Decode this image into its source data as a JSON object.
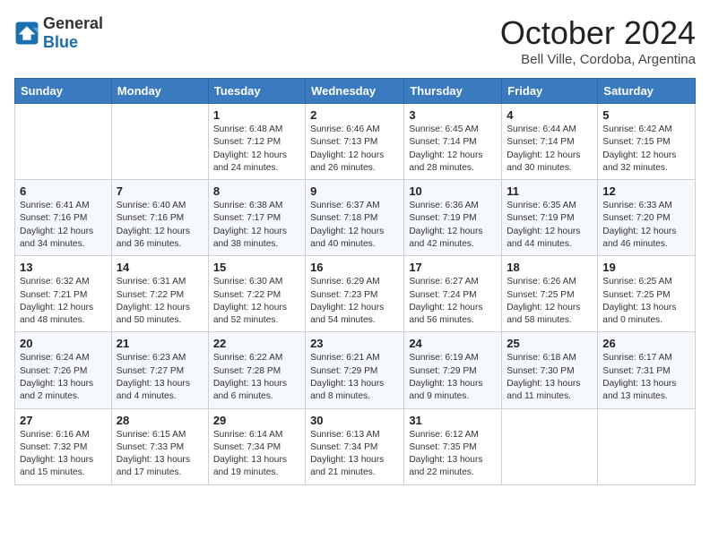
{
  "logo": {
    "general": "General",
    "blue": "Blue"
  },
  "title": "October 2024",
  "location": "Bell Ville, Cordoba, Argentina",
  "weekdays": [
    "Sunday",
    "Monday",
    "Tuesday",
    "Wednesday",
    "Thursday",
    "Friday",
    "Saturday"
  ],
  "weeks": [
    [
      {
        "day": "",
        "info": ""
      },
      {
        "day": "",
        "info": ""
      },
      {
        "day": "1",
        "info": "Sunrise: 6:48 AM\nSunset: 7:12 PM\nDaylight: 12 hours\nand 24 minutes."
      },
      {
        "day": "2",
        "info": "Sunrise: 6:46 AM\nSunset: 7:13 PM\nDaylight: 12 hours\nand 26 minutes."
      },
      {
        "day": "3",
        "info": "Sunrise: 6:45 AM\nSunset: 7:14 PM\nDaylight: 12 hours\nand 28 minutes."
      },
      {
        "day": "4",
        "info": "Sunrise: 6:44 AM\nSunset: 7:14 PM\nDaylight: 12 hours\nand 30 minutes."
      },
      {
        "day": "5",
        "info": "Sunrise: 6:42 AM\nSunset: 7:15 PM\nDaylight: 12 hours\nand 32 minutes."
      }
    ],
    [
      {
        "day": "6",
        "info": "Sunrise: 6:41 AM\nSunset: 7:16 PM\nDaylight: 12 hours\nand 34 minutes."
      },
      {
        "day": "7",
        "info": "Sunrise: 6:40 AM\nSunset: 7:16 PM\nDaylight: 12 hours\nand 36 minutes."
      },
      {
        "day": "8",
        "info": "Sunrise: 6:38 AM\nSunset: 7:17 PM\nDaylight: 12 hours\nand 38 minutes."
      },
      {
        "day": "9",
        "info": "Sunrise: 6:37 AM\nSunset: 7:18 PM\nDaylight: 12 hours\nand 40 minutes."
      },
      {
        "day": "10",
        "info": "Sunrise: 6:36 AM\nSunset: 7:19 PM\nDaylight: 12 hours\nand 42 minutes."
      },
      {
        "day": "11",
        "info": "Sunrise: 6:35 AM\nSunset: 7:19 PM\nDaylight: 12 hours\nand 44 minutes."
      },
      {
        "day": "12",
        "info": "Sunrise: 6:33 AM\nSunset: 7:20 PM\nDaylight: 12 hours\nand 46 minutes."
      }
    ],
    [
      {
        "day": "13",
        "info": "Sunrise: 6:32 AM\nSunset: 7:21 PM\nDaylight: 12 hours\nand 48 minutes."
      },
      {
        "day": "14",
        "info": "Sunrise: 6:31 AM\nSunset: 7:22 PM\nDaylight: 12 hours\nand 50 minutes."
      },
      {
        "day": "15",
        "info": "Sunrise: 6:30 AM\nSunset: 7:22 PM\nDaylight: 12 hours\nand 52 minutes."
      },
      {
        "day": "16",
        "info": "Sunrise: 6:29 AM\nSunset: 7:23 PM\nDaylight: 12 hours\nand 54 minutes."
      },
      {
        "day": "17",
        "info": "Sunrise: 6:27 AM\nSunset: 7:24 PM\nDaylight: 12 hours\nand 56 minutes."
      },
      {
        "day": "18",
        "info": "Sunrise: 6:26 AM\nSunset: 7:25 PM\nDaylight: 12 hours\nand 58 minutes."
      },
      {
        "day": "19",
        "info": "Sunrise: 6:25 AM\nSunset: 7:25 PM\nDaylight: 13 hours\nand 0 minutes."
      }
    ],
    [
      {
        "day": "20",
        "info": "Sunrise: 6:24 AM\nSunset: 7:26 PM\nDaylight: 13 hours\nand 2 minutes."
      },
      {
        "day": "21",
        "info": "Sunrise: 6:23 AM\nSunset: 7:27 PM\nDaylight: 13 hours\nand 4 minutes."
      },
      {
        "day": "22",
        "info": "Sunrise: 6:22 AM\nSunset: 7:28 PM\nDaylight: 13 hours\nand 6 minutes."
      },
      {
        "day": "23",
        "info": "Sunrise: 6:21 AM\nSunset: 7:29 PM\nDaylight: 13 hours\nand 8 minutes."
      },
      {
        "day": "24",
        "info": "Sunrise: 6:19 AM\nSunset: 7:29 PM\nDaylight: 13 hours\nand 9 minutes."
      },
      {
        "day": "25",
        "info": "Sunrise: 6:18 AM\nSunset: 7:30 PM\nDaylight: 13 hours\nand 11 minutes."
      },
      {
        "day": "26",
        "info": "Sunrise: 6:17 AM\nSunset: 7:31 PM\nDaylight: 13 hours\nand 13 minutes."
      }
    ],
    [
      {
        "day": "27",
        "info": "Sunrise: 6:16 AM\nSunset: 7:32 PM\nDaylight: 13 hours\nand 15 minutes."
      },
      {
        "day": "28",
        "info": "Sunrise: 6:15 AM\nSunset: 7:33 PM\nDaylight: 13 hours\nand 17 minutes."
      },
      {
        "day": "29",
        "info": "Sunrise: 6:14 AM\nSunset: 7:34 PM\nDaylight: 13 hours\nand 19 minutes."
      },
      {
        "day": "30",
        "info": "Sunrise: 6:13 AM\nSunset: 7:34 PM\nDaylight: 13 hours\nand 21 minutes."
      },
      {
        "day": "31",
        "info": "Sunrise: 6:12 AM\nSunset: 7:35 PM\nDaylight: 13 hours\nand 22 minutes."
      },
      {
        "day": "",
        "info": ""
      },
      {
        "day": "",
        "info": ""
      }
    ]
  ]
}
